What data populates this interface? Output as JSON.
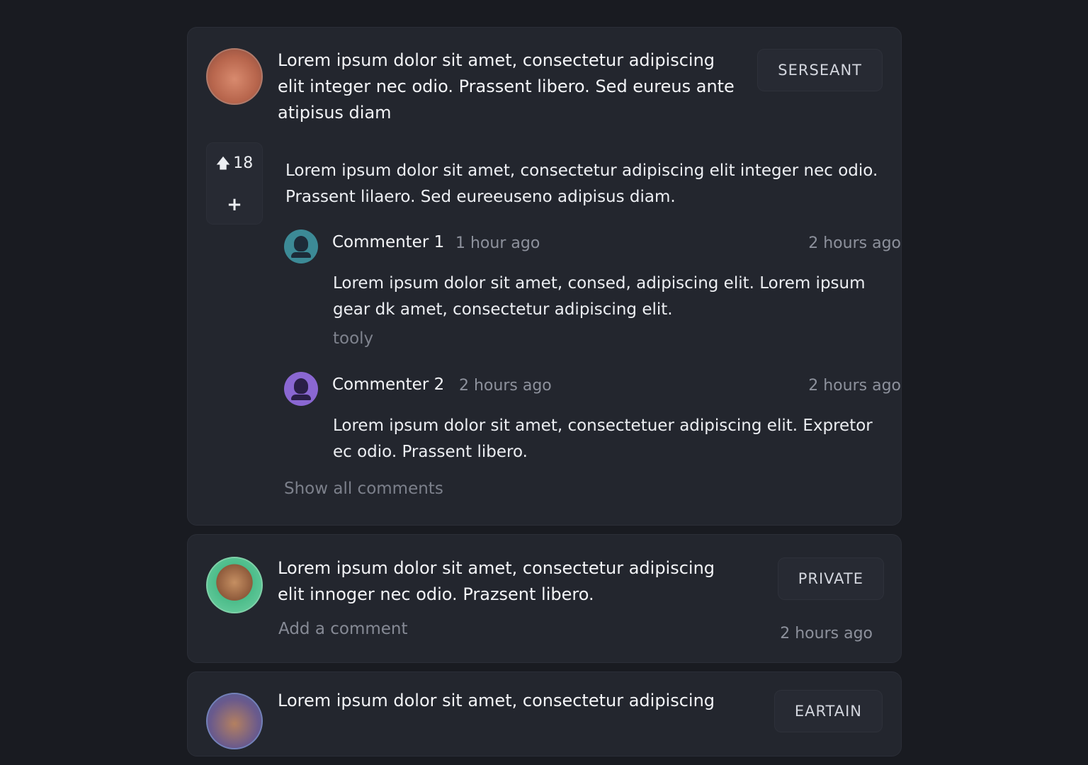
{
  "posts": [
    {
      "text": "Lorem ipsum dolor sit amet, consectetur adipiscing elit  integer nec odio. Prassent libero. Sed eureus ante atipisus  diam",
      "tag": "SERSEANT",
      "votes": "18",
      "add_label": "+",
      "body": "Lorem ipsum dolor sit amet, consectetur adipiscing elit  integer nec odio. Prassent lilaero. Sed eureeuseno adipisus  diam.",
      "comments": [
        {
          "name": "Commenter 1",
          "meta": "1 hour ago",
          "time": "2 hours ago",
          "text": "Lorem ipsum dolor sit amet, consed, adipiscing elit. Lorem ipsum gear dk amet, consectetur adipiscing elit.",
          "tag": "tooly"
        },
        {
          "name": "Commenter  2",
          "meta": "2 hours ago",
          "time": "2 hours ago",
          "text": "Lorem ipsum dolor sit amet, consectetuer adipiscing elit. Expretor ec odio. Prassent libero."
        }
      ],
      "show_all": "Show all comments"
    },
    {
      "text": "Lorem ipsum dolor sit amet, consectetur adipiscing elit  innoger nec odio. Prazsent libero.",
      "tag": "PRIVATE",
      "add_comment": "Add a comment",
      "time": "2 hours ago"
    },
    {
      "text": "Lorem ipsum dolor sit amet, consectetur adipiscing",
      "tag": "EARTAIN"
    }
  ],
  "icons": {
    "vote": "arrow-up-icon",
    "add": "plus-icon"
  }
}
